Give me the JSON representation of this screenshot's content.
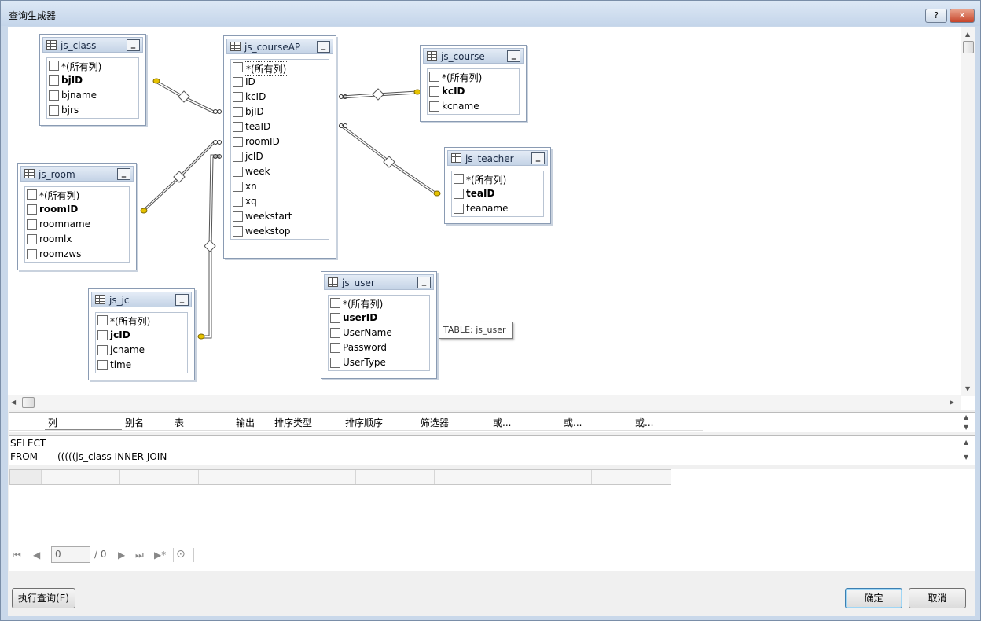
{
  "window": {
    "title": "查询生成器",
    "help_label": "?",
    "close_label": "✕"
  },
  "tables": {
    "js_class": {
      "name": "js_class",
      "columns": [
        "*(所有列)",
        "bjID",
        "bjname",
        "bjrs"
      ]
    },
    "js_courseAP": {
      "name": "js_courseAP",
      "columns": [
        "*(所有列)",
        "ID",
        "kcID",
        "bjID",
        "teaID",
        "roomID",
        "jcID",
        "week",
        "xn",
        "xq",
        "weekstart",
        "weekstop"
      ]
    },
    "js_course": {
      "name": "js_course",
      "columns": [
        "*(所有列)",
        "kcID",
        "kcname"
      ]
    },
    "js_teacher": {
      "name": "js_teacher",
      "columns": [
        "*(所有列)",
        "teaID",
        "teaname"
      ]
    },
    "js_room": {
      "name": "js_room",
      "columns": [
        "*(所有列)",
        "roomID",
        "roomname",
        "roomlx",
        "roomzws"
      ]
    },
    "js_jc": {
      "name": "js_jc",
      "columns": [
        "*(所有列)",
        "jcID",
        "jcname",
        "time"
      ]
    },
    "js_user": {
      "name": "js_user",
      "columns": [
        "*(所有列)",
        "userID",
        "UserName",
        "Password",
        "UserType"
      ]
    }
  },
  "minimize_label": "_",
  "tooltip": "TABLE: js_user",
  "grid": {
    "headers": [
      "列",
      "别名",
      "表",
      "输出",
      "排序类型",
      "排序顺序",
      "筛选器",
      "或...",
      "或...",
      "或..."
    ]
  },
  "sql": {
    "select_kw": "SELECT",
    "from_kw": "FROM",
    "from_val": "(((((js_class INNER JOIN"
  },
  "navigator": {
    "page": "0",
    "total": "/ 0"
  },
  "buttons": {
    "execute": "执行查询(E)",
    "ok": "确定",
    "cancel": "取消"
  }
}
